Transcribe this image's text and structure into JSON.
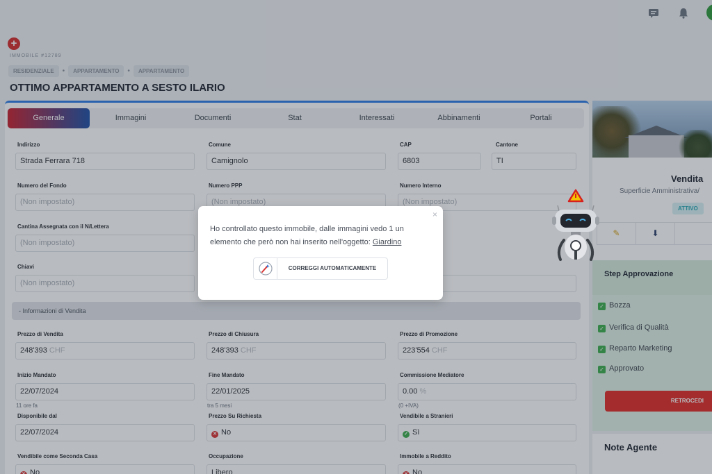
{
  "property": {
    "id_label": "IMMOBILE #12789",
    "breadcrumbs": [
      "RESIDENZIALE",
      "APPARTAMENTO",
      "APPARTAMENTO"
    ],
    "title": "OTTIMO APPARTAMENTO A SESTO ILARIO"
  },
  "tabs": [
    "Generale",
    "Immagini",
    "Documenti",
    "Stat",
    "Interessati",
    "Abbinamenti",
    "Portali"
  ],
  "form": {
    "indirizzo": {
      "label": "Indirizzo",
      "value": "Strada Ferrara 718"
    },
    "comune": {
      "label": "Comune",
      "value": "Camignolo"
    },
    "cap": {
      "label": "CAP",
      "value": "6803"
    },
    "cantone": {
      "label": "Cantone",
      "value": "TI"
    },
    "numero_fondo": {
      "label": "Numero del Fondo",
      "value": "(Non impostato)"
    },
    "numero_ppp": {
      "label": "Numero PPP",
      "value": "(Non impostato)"
    },
    "numero_interno": {
      "label": "Numero Interno",
      "value": "(Non impostato)"
    },
    "cantina": {
      "label": "Cantina Assegnata con il N/Lettera",
      "value": "(Non impostato)"
    },
    "chiavi": {
      "label": "Chiavi",
      "value": "(Non impostato)"
    },
    "section_vendita": "- Informazioni di Vendita",
    "prezzo_vendita": {
      "label": "Prezzo di Vendita",
      "value": "248'393",
      "unit": "CHF"
    },
    "prezzo_chiusura": {
      "label": "Prezzo di Chiusura",
      "value": "248'393",
      "unit": "CHF"
    },
    "prezzo_promozione": {
      "label": "Prezzo di Promozione",
      "value": "223'554",
      "unit": "CHF"
    },
    "inizio_mandato": {
      "label": "Inizio Mandato",
      "value": "22/07/2024",
      "hint": "11 ore fa"
    },
    "fine_mandato": {
      "label": "Fine Mandato",
      "value": "22/01/2025",
      "hint": "tra 5 mesi"
    },
    "commissione": {
      "label": "Commissione Mediatore",
      "value": "0.00",
      "unit": "%",
      "hint": "(0 +IVA)"
    },
    "disponibile": {
      "label": "Disponibile dal",
      "value": "22/07/2024"
    },
    "prezzo_richiesta": {
      "label": "Prezzo Su Richiesta",
      "value": "No"
    },
    "vendibile_stranieri": {
      "label": "Vendibile a Stranieri",
      "value": "Sì"
    },
    "seconda_casa": {
      "label": "Vendibile come Seconda Casa",
      "value": "No"
    },
    "occupazione": {
      "label": "Occupazione",
      "value": "Libero"
    },
    "reddito": {
      "label": "Immobile a Reddito",
      "value": "No"
    }
  },
  "sidebar": {
    "title": "Vendita",
    "subtitle": "Superficie Amministrativa/",
    "badge": "ATTIVO",
    "approval_title": "Step Approvazione",
    "approval_steps": [
      "Bozza",
      "Verifica di Qualità",
      "Reparto Marketing",
      "Approvato"
    ],
    "retrocedi": "RETROCEDI",
    "notes_title": "Note Agente"
  },
  "modal": {
    "text": "Ho controllato questo immobile, dalle immagini vedo 1 un elemento che però non hai inserito nell'oggetto: ",
    "link": "Giardino",
    "button": "CORREGGI AUTOMATICAMENTE",
    "close": "×"
  },
  "icons": {
    "chat": "chat-icon",
    "bell": "bell-icon",
    "edit": "pencil-icon",
    "download": "download-icon",
    "warning": "warning-icon"
  },
  "colors": {
    "accent_blue": "#2c7be5",
    "tab_gradient_start": "#c8202e",
    "tab_gradient_end": "#1d4fa6",
    "retrocedi_red": "#e22b26",
    "badge_teal": "#2aa7b5",
    "check_green": "#3cae4c"
  }
}
